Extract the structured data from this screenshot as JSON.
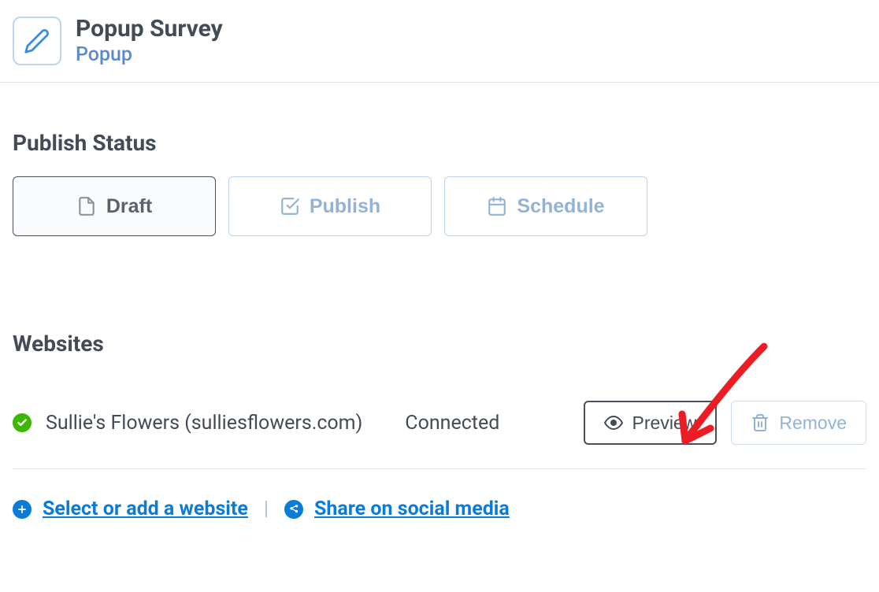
{
  "header": {
    "title": "Popup Survey",
    "subtitle": "Popup"
  },
  "publish_status": {
    "heading": "Publish Status",
    "buttons": {
      "draft": "Draft",
      "publish": "Publish",
      "schedule": "Schedule"
    }
  },
  "websites": {
    "heading": "Websites",
    "items": [
      {
        "name": "Sullie's Flowers (sulliesflowers.com)",
        "status": "Connected"
      }
    ],
    "actions": {
      "preview": "Preview",
      "remove": "Remove"
    },
    "links": {
      "add_website": "Select or add a website",
      "share": "Share on social media"
    }
  }
}
